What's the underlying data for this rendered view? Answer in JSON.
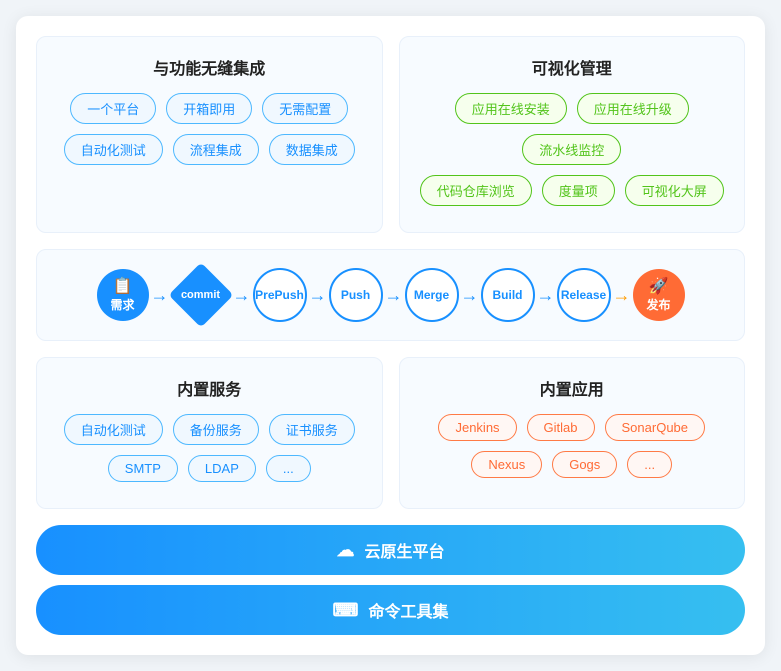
{
  "top_left": {
    "title": "与功能无缝集成",
    "row1": [
      "一个平台",
      "开箱即用",
      "无需配置"
    ],
    "row2": [
      "自动化测试",
      "流程集成",
      "数据集成"
    ]
  },
  "top_right": {
    "title": "可视化管理",
    "row1": [
      "应用在线安装",
      "应用在线升级",
      "流水线监控"
    ],
    "row2": [
      "代码仓库浏览",
      "度量项",
      "可视化大屏"
    ]
  },
  "pipeline": {
    "nodes": [
      {
        "id": "xq",
        "label": "需求",
        "type": "circle-blue",
        "icon": "📋"
      },
      {
        "id": "commit",
        "label": "commit",
        "type": "diamond"
      },
      {
        "id": "prepush",
        "label": "PrePush",
        "type": "circle-outline"
      },
      {
        "id": "push",
        "label": "Push",
        "type": "circle-outline"
      },
      {
        "id": "merge",
        "label": "Merge",
        "type": "circle-outline"
      },
      {
        "id": "build",
        "label": "Build",
        "type": "circle-outline"
      },
      {
        "id": "release",
        "label": "Release",
        "type": "circle-outline"
      },
      {
        "id": "fb",
        "label": "发布",
        "type": "circle-orange",
        "icon": "🚀"
      }
    ]
  },
  "bottom_left": {
    "title": "内置服务",
    "row1": [
      "自动化测试",
      "备份服务",
      "证书服务"
    ],
    "row2": [
      "SMTP",
      "LDAP",
      "..."
    ]
  },
  "bottom_right": {
    "title": "内置应用",
    "row1": [
      "Jenkins",
      "Gitlab",
      "SonarQube"
    ],
    "row2": [
      "Nexus",
      "Gogs",
      "..."
    ]
  },
  "buttons": [
    {
      "id": "cloud",
      "icon": "☁",
      "label": "云原生平台"
    },
    {
      "id": "cmd",
      "icon": "⌨",
      "label": "命令工具集"
    }
  ]
}
